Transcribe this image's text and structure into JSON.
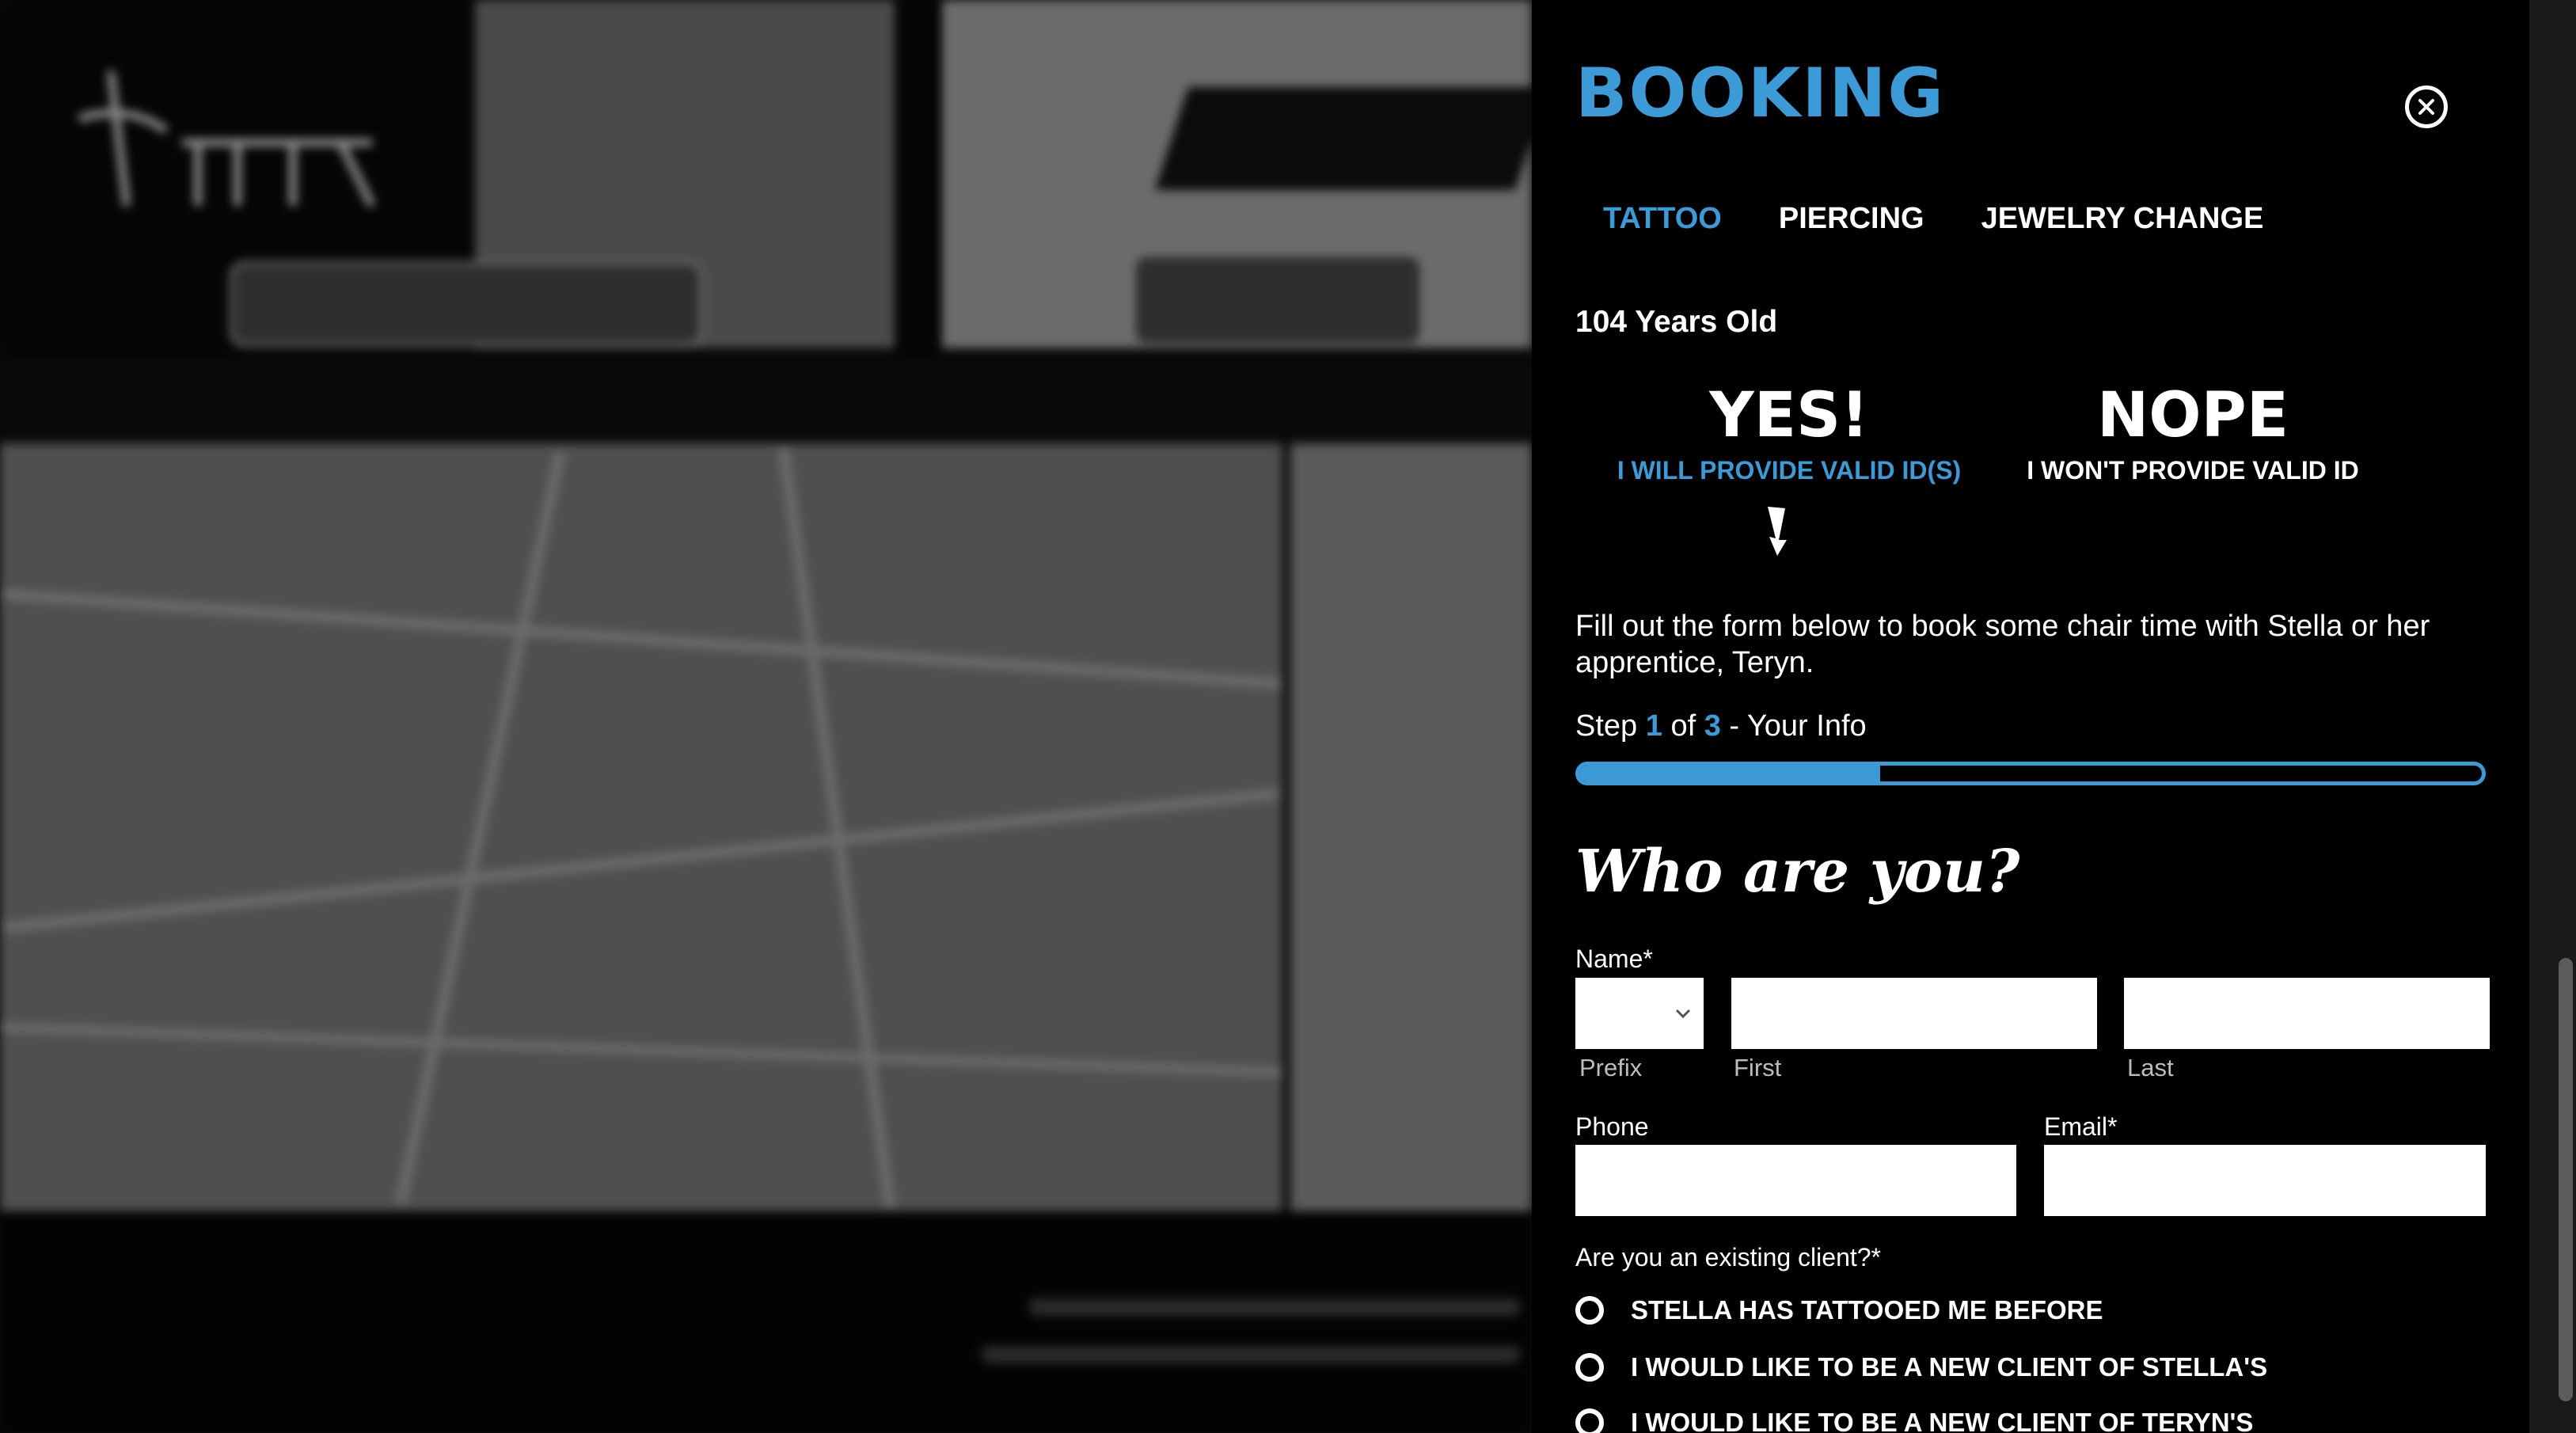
{
  "booking": {
    "title": "BOOKING",
    "tabs": [
      {
        "label": "TATTOO",
        "active": true
      },
      {
        "label": "PIERCING",
        "active": false
      },
      {
        "label": "JEWELRY CHANGE",
        "active": false
      }
    ],
    "age_label": "104 Years Old",
    "choices": {
      "yes": {
        "big": "YES!",
        "sub": "I WILL PROVIDE VALID ID(S)"
      },
      "no": {
        "big": "NOPE",
        "sub": "I WON'T PROVIDE VALID ID"
      }
    },
    "intro": "Fill out the form below to book some chair time with Stella or her apprentice, Teryn.",
    "step": {
      "prefix": "Step",
      "current": "1",
      "of": "of",
      "total": "3",
      "suffix": "- Your Info",
      "progress_fraction": 0.333
    },
    "heading": "Who are you?",
    "name": {
      "label": "Name*",
      "prefix_label": "Prefix",
      "first_label": "First",
      "last_label": "Last",
      "prefix_value": "",
      "first_value": "",
      "last_value": ""
    },
    "phone": {
      "label": "Phone",
      "value": ""
    },
    "email": {
      "label": "Email*",
      "value": ""
    },
    "existing_client": {
      "question": "Are you an existing client?*",
      "options": [
        "STELLA HAS TATTOOED ME BEFORE",
        "I WOULD LIKE TO BE A NEW CLIENT OF STELLA'S",
        "I WOULD LIKE TO BE A NEW CLIENT OF TERYN'S"
      ]
    },
    "colors": {
      "accent": "#3c9ad6",
      "background": "#000000",
      "text": "#ffffff"
    }
  }
}
